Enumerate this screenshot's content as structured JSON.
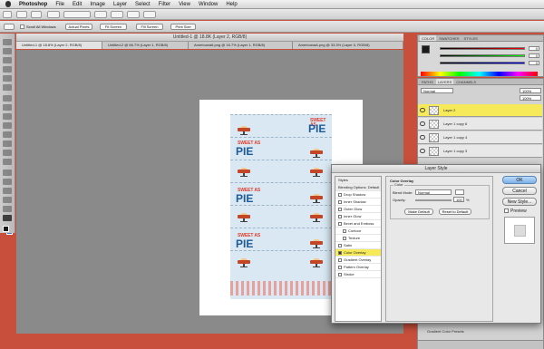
{
  "menubar": {
    "app": "Photoshop",
    "items": [
      "File",
      "Edit",
      "Image",
      "Layer",
      "Select",
      "Filter",
      "View",
      "Window",
      "Help"
    ]
  },
  "options": {
    "scroll_all": "Scroll All Windows",
    "actual_pixels": "Actual Pixels",
    "fit_screen": "Fit Screen",
    "fill_screen": "Fill Screen",
    "print_size": "Print Size"
  },
  "document": {
    "title": "Untitled-1 @ 18.8K (Layer 2, RGB/8)"
  },
  "tabs": [
    "Untitled-1 @ 18.8% (Layer 2, RGB/8)",
    "Untitled-2 @ 66.7% (Layer 1, RGB/8)",
    "Americana6.png @ 16.7% (Layer 1, RGB/8)",
    "AmericanaA.png @ 33.3% (Layer 0, RGB/8)"
  ],
  "artwork": {
    "sweet": "SWEET AS",
    "pie": "PIE"
  },
  "color_panel": {
    "tabs": [
      "COLOR",
      "SWATCHES",
      "STYLES"
    ],
    "r": "0",
    "g": "0",
    "b": "0",
    "colors": {
      "fg": "#1a1a1a",
      "bg": "#3b7fd0"
    }
  },
  "layers_panel": {
    "tabs": [
      "PATHS",
      "LAYERS",
      "CHANNELS"
    ],
    "blend": "Normal",
    "opacity": "100%",
    "fill": "100%",
    "layers": [
      {
        "name": "Layer 2",
        "selected": true
      },
      {
        "name": "Layer 1 copy 6",
        "selected": false
      },
      {
        "name": "Layer 1 copy 4",
        "selected": false
      },
      {
        "name": "Layer 1 copy 3",
        "selected": false
      }
    ],
    "bottom_label": "Gradient Color Presets"
  },
  "dialog": {
    "title": "Layer Style",
    "list": [
      "Styles",
      "Blending Options: Default",
      "Drop Shadow",
      "Inner Shadow",
      "Outer Glow",
      "Inner Glow",
      "Bevel and Emboss",
      "Contour",
      "Texture",
      "Satin",
      "Color Overlay",
      "Gradient Overlay",
      "Pattern Overlay",
      "Stroke"
    ],
    "section": "Color Overlay",
    "group": "Color",
    "blend_mode_label": "Blend Mode:",
    "blend_mode": "Normal",
    "opacity_label": "Opacity:",
    "opacity": "100",
    "pct": "%",
    "make_default": "Make Default",
    "reset_default": "Reset to Default",
    "ok": "OK",
    "cancel": "Cancel",
    "new_style": "New Style...",
    "preview": "Preview"
  }
}
